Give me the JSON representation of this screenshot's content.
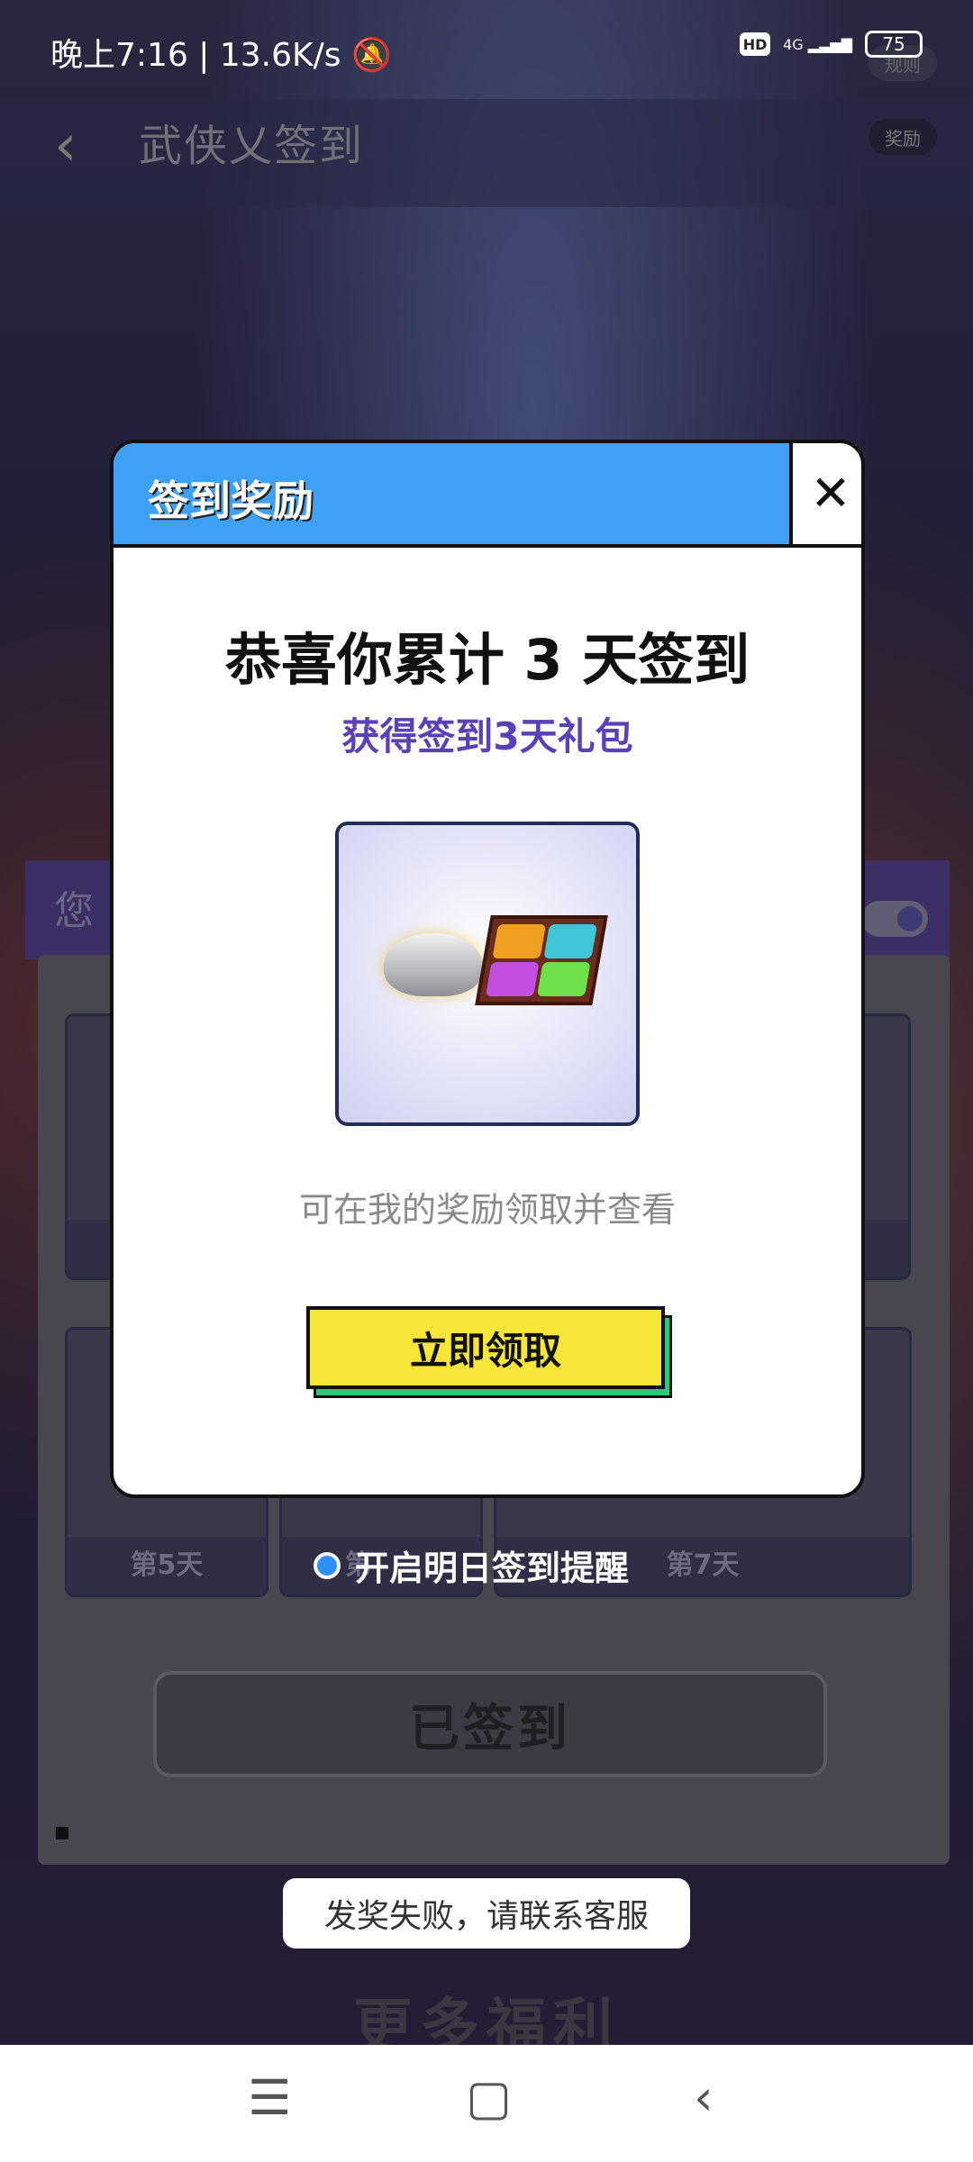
{
  "status_bar": {
    "time_text": "晚上7:16 | 13.6K/s",
    "network": "4G",
    "battery": "75",
    "icons": [
      "bell-off-icon",
      "hd-icon",
      "signal-icon",
      "battery-icon"
    ]
  },
  "header": {
    "title": "武侠乂签到",
    "rules_label": "规则",
    "reward_label": "奖励"
  },
  "background": {
    "panel_label": "您",
    "days": [
      {
        "label": "第5天"
      },
      {
        "label": "第"
      },
      {
        "label": "第7天"
      }
    ],
    "signed_label": "已签到",
    "reminder_label": "开启明日签到提醒",
    "more_banner": "更多福利"
  },
  "modal": {
    "title": "签到奖励",
    "congrats": "恭喜你累计 3 天签到",
    "gift_name": "获得签到3天礼包",
    "hint": "可在我的奖励领取并查看",
    "claim_label": "立即领取"
  },
  "toast": {
    "text": "发奖失败，请联系客服"
  },
  "colors": {
    "modal_header": "#3fa1f5",
    "claim_button": "#f7e53a",
    "claim_shadow": "#2ec77a",
    "gift_name": "#5c40b8"
  }
}
